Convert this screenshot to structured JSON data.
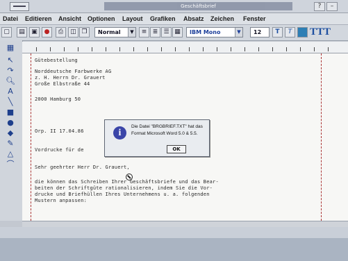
{
  "window": {
    "title": "Geschäftsbrief"
  },
  "menu": [
    {
      "label": "Datei"
    },
    {
      "label": "Editieren"
    },
    {
      "label": "Ansicht"
    },
    {
      "label": "Optionen"
    },
    {
      "label": "Layout"
    },
    {
      "label": "Grafiken"
    },
    {
      "label": "Absatz"
    },
    {
      "label": "Zeichen"
    },
    {
      "label": "Fenster"
    }
  ],
  "toolbar": {
    "style_value": "Normal",
    "font_value": "IBM Mono",
    "size_value": "12",
    "text_glyphs": "TTT"
  },
  "document": {
    "lines": [
      "Gütebestellung",
      "Norddeutsche Farbwerke AG",
      "z. H. Herrn Dr. Grauert",
      "Große Elbstraße 44",
      "2000 Hamburg 50",
      "Orp. II 17.04.86",
      "Vordrucke für de",
      "Sehr geehrter Herr Dr. Grauert,",
      "die können das Schreiben Ihrer Geschäftsbriefe und das Bear-",
      "beiten der Schriftgüte rationalisieren, indem Sie die Vor-",
      "drucke und Briefhüllen Ihres Unternehmens u. a. folgenden",
      "Mustern anpassen:"
    ]
  },
  "dialog": {
    "line1": "Die Datei \"BRGBRIEF.TXT\" hat das",
    "line2": "Format Microsoft Word 5.0 & 5.5.",
    "ok_label": "OK",
    "icon": "info-icon"
  },
  "colors": {
    "accent": "#3a45a8",
    "guide": "#aa3333"
  }
}
